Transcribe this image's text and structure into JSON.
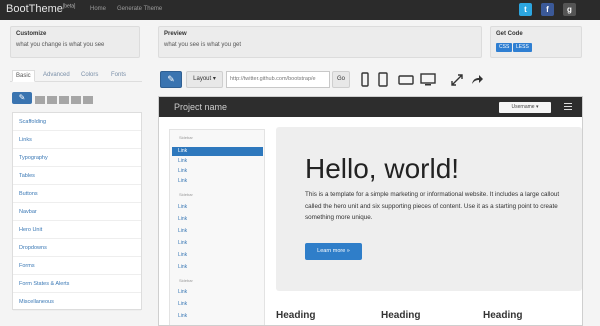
{
  "app": {
    "brand": "BootTheme",
    "brand_sup": "[beta]",
    "nav": [
      "Home",
      "Generate Theme"
    ],
    "social_icons": [
      {
        "name": "twitter",
        "glyph": "t",
        "color": "#2ca6e0"
      },
      {
        "name": "facebook",
        "glyph": "f",
        "color": "#3b5998"
      },
      {
        "name": "google-plus",
        "glyph": "g",
        "color": "#555555"
      }
    ]
  },
  "info": {
    "customize": {
      "title": "Customize",
      "text": "what you change is what you see"
    },
    "preview": {
      "title": "Preview",
      "text": "what you see is what you get"
    },
    "getcode": {
      "title": "Get Code",
      "buttons": [
        "CSS",
        "LESS"
      ]
    }
  },
  "left": {
    "tabs": [
      "Basic",
      "Advanced",
      "Colors",
      "Fonts"
    ],
    "menu": [
      "Scaffolding",
      "Links",
      "Typography",
      "Tables",
      "Buttons",
      "Navbar",
      "Hero Unit",
      "Dropdowns",
      "Forms",
      "Form States & Alerts",
      "Miscellaneous"
    ]
  },
  "toolbar": {
    "layout_label": "Layout",
    "url": "http://twitter.github.com/bootstrap/e",
    "go_label": "Go"
  },
  "preview": {
    "brand": "Project name",
    "user_label": "Username",
    "sidenav": {
      "headers": [
        "Sidebar",
        "Sidebar",
        "Sidebar"
      ],
      "links": [
        "Link",
        "Link",
        "Link",
        "Link",
        "Link",
        "Link",
        "Link",
        "Link",
        "Link",
        "Link",
        "Link",
        "Link",
        "Link",
        "Link",
        "Link",
        "Link",
        "Link",
        "Link"
      ]
    },
    "hero": {
      "title": "Hello, world!",
      "text": "This is a template for a simple marketing or informational website. It includes a large callout called the hero unit and six supporting pieces of content. Use it as a starting point to create something more unique.",
      "button": "Learn more »"
    },
    "headings": [
      "Heading",
      "Heading",
      "Heading"
    ]
  },
  "colors": {
    "accent": "#2f7ec9",
    "navbar": "#2b2b2b"
  }
}
